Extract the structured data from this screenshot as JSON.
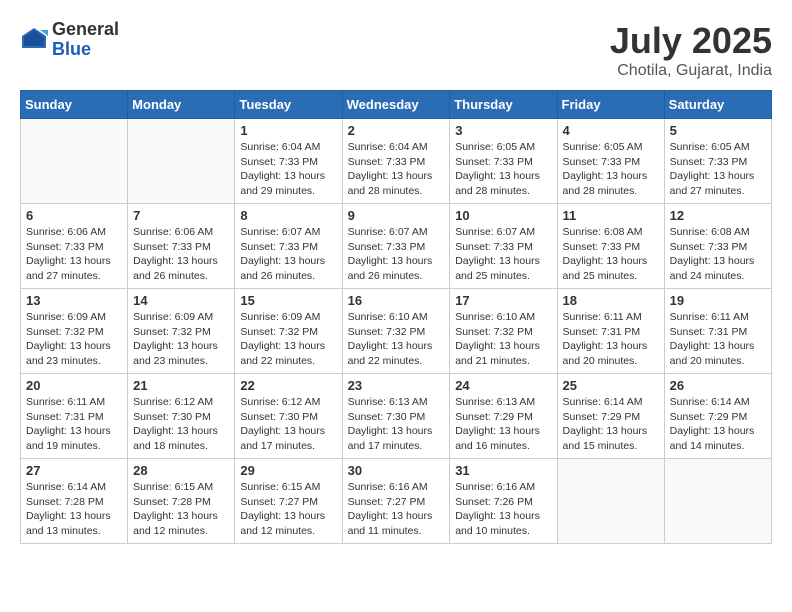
{
  "header": {
    "logo_general": "General",
    "logo_blue": "Blue",
    "month_title": "July 2025",
    "location": "Chotila, Gujarat, India"
  },
  "calendar": {
    "days_of_week": [
      "Sunday",
      "Monday",
      "Tuesday",
      "Wednesday",
      "Thursday",
      "Friday",
      "Saturday"
    ],
    "weeks": [
      [
        {
          "day": "",
          "info": ""
        },
        {
          "day": "",
          "info": ""
        },
        {
          "day": "1",
          "info": "Sunrise: 6:04 AM\nSunset: 7:33 PM\nDaylight: 13 hours and 29 minutes."
        },
        {
          "day": "2",
          "info": "Sunrise: 6:04 AM\nSunset: 7:33 PM\nDaylight: 13 hours and 28 minutes."
        },
        {
          "day": "3",
          "info": "Sunrise: 6:05 AM\nSunset: 7:33 PM\nDaylight: 13 hours and 28 minutes."
        },
        {
          "day": "4",
          "info": "Sunrise: 6:05 AM\nSunset: 7:33 PM\nDaylight: 13 hours and 28 minutes."
        },
        {
          "day": "5",
          "info": "Sunrise: 6:05 AM\nSunset: 7:33 PM\nDaylight: 13 hours and 27 minutes."
        }
      ],
      [
        {
          "day": "6",
          "info": "Sunrise: 6:06 AM\nSunset: 7:33 PM\nDaylight: 13 hours and 27 minutes."
        },
        {
          "day": "7",
          "info": "Sunrise: 6:06 AM\nSunset: 7:33 PM\nDaylight: 13 hours and 26 minutes."
        },
        {
          "day": "8",
          "info": "Sunrise: 6:07 AM\nSunset: 7:33 PM\nDaylight: 13 hours and 26 minutes."
        },
        {
          "day": "9",
          "info": "Sunrise: 6:07 AM\nSunset: 7:33 PM\nDaylight: 13 hours and 26 minutes."
        },
        {
          "day": "10",
          "info": "Sunrise: 6:07 AM\nSunset: 7:33 PM\nDaylight: 13 hours and 25 minutes."
        },
        {
          "day": "11",
          "info": "Sunrise: 6:08 AM\nSunset: 7:33 PM\nDaylight: 13 hours and 25 minutes."
        },
        {
          "day": "12",
          "info": "Sunrise: 6:08 AM\nSunset: 7:33 PM\nDaylight: 13 hours and 24 minutes."
        }
      ],
      [
        {
          "day": "13",
          "info": "Sunrise: 6:09 AM\nSunset: 7:32 PM\nDaylight: 13 hours and 23 minutes."
        },
        {
          "day": "14",
          "info": "Sunrise: 6:09 AM\nSunset: 7:32 PM\nDaylight: 13 hours and 23 minutes."
        },
        {
          "day": "15",
          "info": "Sunrise: 6:09 AM\nSunset: 7:32 PM\nDaylight: 13 hours and 22 minutes."
        },
        {
          "day": "16",
          "info": "Sunrise: 6:10 AM\nSunset: 7:32 PM\nDaylight: 13 hours and 22 minutes."
        },
        {
          "day": "17",
          "info": "Sunrise: 6:10 AM\nSunset: 7:32 PM\nDaylight: 13 hours and 21 minutes."
        },
        {
          "day": "18",
          "info": "Sunrise: 6:11 AM\nSunset: 7:31 PM\nDaylight: 13 hours and 20 minutes."
        },
        {
          "day": "19",
          "info": "Sunrise: 6:11 AM\nSunset: 7:31 PM\nDaylight: 13 hours and 20 minutes."
        }
      ],
      [
        {
          "day": "20",
          "info": "Sunrise: 6:11 AM\nSunset: 7:31 PM\nDaylight: 13 hours and 19 minutes."
        },
        {
          "day": "21",
          "info": "Sunrise: 6:12 AM\nSunset: 7:30 PM\nDaylight: 13 hours and 18 minutes."
        },
        {
          "day": "22",
          "info": "Sunrise: 6:12 AM\nSunset: 7:30 PM\nDaylight: 13 hours and 17 minutes."
        },
        {
          "day": "23",
          "info": "Sunrise: 6:13 AM\nSunset: 7:30 PM\nDaylight: 13 hours and 17 minutes."
        },
        {
          "day": "24",
          "info": "Sunrise: 6:13 AM\nSunset: 7:29 PM\nDaylight: 13 hours and 16 minutes."
        },
        {
          "day": "25",
          "info": "Sunrise: 6:14 AM\nSunset: 7:29 PM\nDaylight: 13 hours and 15 minutes."
        },
        {
          "day": "26",
          "info": "Sunrise: 6:14 AM\nSunset: 7:29 PM\nDaylight: 13 hours and 14 minutes."
        }
      ],
      [
        {
          "day": "27",
          "info": "Sunrise: 6:14 AM\nSunset: 7:28 PM\nDaylight: 13 hours and 13 minutes."
        },
        {
          "day": "28",
          "info": "Sunrise: 6:15 AM\nSunset: 7:28 PM\nDaylight: 13 hours and 12 minutes."
        },
        {
          "day": "29",
          "info": "Sunrise: 6:15 AM\nSunset: 7:27 PM\nDaylight: 13 hours and 12 minutes."
        },
        {
          "day": "30",
          "info": "Sunrise: 6:16 AM\nSunset: 7:27 PM\nDaylight: 13 hours and 11 minutes."
        },
        {
          "day": "31",
          "info": "Sunrise: 6:16 AM\nSunset: 7:26 PM\nDaylight: 13 hours and 10 minutes."
        },
        {
          "day": "",
          "info": ""
        },
        {
          "day": "",
          "info": ""
        }
      ]
    ]
  }
}
